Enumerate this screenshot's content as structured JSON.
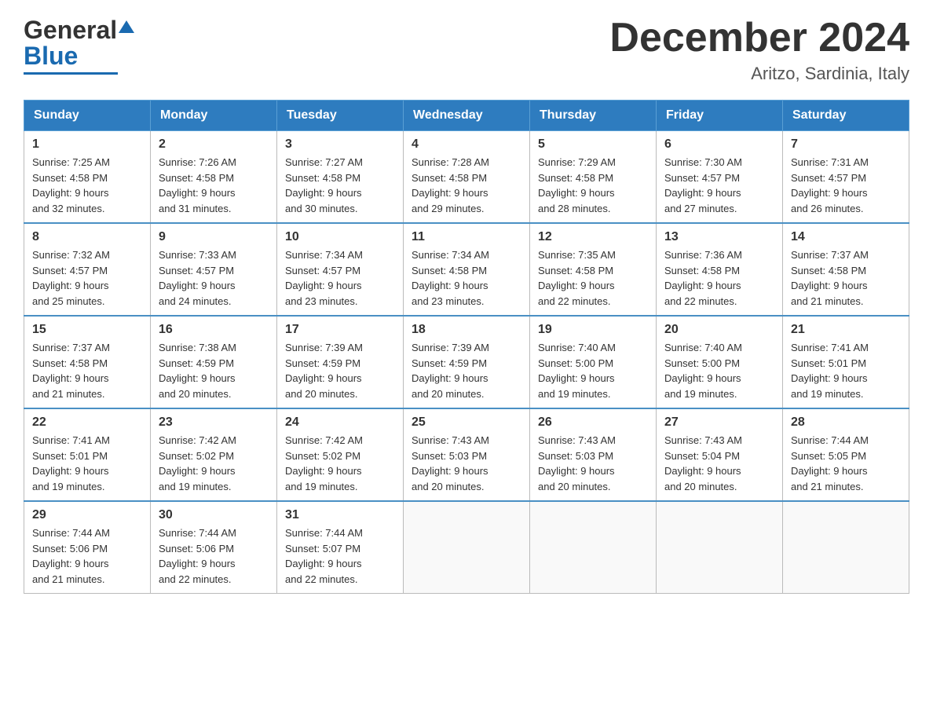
{
  "header": {
    "logo_general": "General",
    "logo_blue": "Blue",
    "main_title": "December 2024",
    "subtitle": "Aritzo, Sardinia, Italy"
  },
  "days_of_week": [
    "Sunday",
    "Monday",
    "Tuesday",
    "Wednesday",
    "Thursday",
    "Friday",
    "Saturday"
  ],
  "weeks": [
    [
      {
        "num": "1",
        "sunrise": "7:25 AM",
        "sunset": "4:58 PM",
        "daylight": "9 hours and 32 minutes."
      },
      {
        "num": "2",
        "sunrise": "7:26 AM",
        "sunset": "4:58 PM",
        "daylight": "9 hours and 31 minutes."
      },
      {
        "num": "3",
        "sunrise": "7:27 AM",
        "sunset": "4:58 PM",
        "daylight": "9 hours and 30 minutes."
      },
      {
        "num": "4",
        "sunrise": "7:28 AM",
        "sunset": "4:58 PM",
        "daylight": "9 hours and 29 minutes."
      },
      {
        "num": "5",
        "sunrise": "7:29 AM",
        "sunset": "4:58 PM",
        "daylight": "9 hours and 28 minutes."
      },
      {
        "num": "6",
        "sunrise": "7:30 AM",
        "sunset": "4:57 PM",
        "daylight": "9 hours and 27 minutes."
      },
      {
        "num": "7",
        "sunrise": "7:31 AM",
        "sunset": "4:57 PM",
        "daylight": "9 hours and 26 minutes."
      }
    ],
    [
      {
        "num": "8",
        "sunrise": "7:32 AM",
        "sunset": "4:57 PM",
        "daylight": "9 hours and 25 minutes."
      },
      {
        "num": "9",
        "sunrise": "7:33 AM",
        "sunset": "4:57 PM",
        "daylight": "9 hours and 24 minutes."
      },
      {
        "num": "10",
        "sunrise": "7:34 AM",
        "sunset": "4:57 PM",
        "daylight": "9 hours and 23 minutes."
      },
      {
        "num": "11",
        "sunrise": "7:34 AM",
        "sunset": "4:58 PM",
        "daylight": "9 hours and 23 minutes."
      },
      {
        "num": "12",
        "sunrise": "7:35 AM",
        "sunset": "4:58 PM",
        "daylight": "9 hours and 22 minutes."
      },
      {
        "num": "13",
        "sunrise": "7:36 AM",
        "sunset": "4:58 PM",
        "daylight": "9 hours and 22 minutes."
      },
      {
        "num": "14",
        "sunrise": "7:37 AM",
        "sunset": "4:58 PM",
        "daylight": "9 hours and 21 minutes."
      }
    ],
    [
      {
        "num": "15",
        "sunrise": "7:37 AM",
        "sunset": "4:58 PM",
        "daylight": "9 hours and 21 minutes."
      },
      {
        "num": "16",
        "sunrise": "7:38 AM",
        "sunset": "4:59 PM",
        "daylight": "9 hours and 20 minutes."
      },
      {
        "num": "17",
        "sunrise": "7:39 AM",
        "sunset": "4:59 PM",
        "daylight": "9 hours and 20 minutes."
      },
      {
        "num": "18",
        "sunrise": "7:39 AM",
        "sunset": "4:59 PM",
        "daylight": "9 hours and 20 minutes."
      },
      {
        "num": "19",
        "sunrise": "7:40 AM",
        "sunset": "5:00 PM",
        "daylight": "9 hours and 19 minutes."
      },
      {
        "num": "20",
        "sunrise": "7:40 AM",
        "sunset": "5:00 PM",
        "daylight": "9 hours and 19 minutes."
      },
      {
        "num": "21",
        "sunrise": "7:41 AM",
        "sunset": "5:01 PM",
        "daylight": "9 hours and 19 minutes."
      }
    ],
    [
      {
        "num": "22",
        "sunrise": "7:41 AM",
        "sunset": "5:01 PM",
        "daylight": "9 hours and 19 minutes."
      },
      {
        "num": "23",
        "sunrise": "7:42 AM",
        "sunset": "5:02 PM",
        "daylight": "9 hours and 19 minutes."
      },
      {
        "num": "24",
        "sunrise": "7:42 AM",
        "sunset": "5:02 PM",
        "daylight": "9 hours and 19 minutes."
      },
      {
        "num": "25",
        "sunrise": "7:43 AM",
        "sunset": "5:03 PM",
        "daylight": "9 hours and 20 minutes."
      },
      {
        "num": "26",
        "sunrise": "7:43 AM",
        "sunset": "5:03 PM",
        "daylight": "9 hours and 20 minutes."
      },
      {
        "num": "27",
        "sunrise": "7:43 AM",
        "sunset": "5:04 PM",
        "daylight": "9 hours and 20 minutes."
      },
      {
        "num": "28",
        "sunrise": "7:44 AM",
        "sunset": "5:05 PM",
        "daylight": "9 hours and 21 minutes."
      }
    ],
    [
      {
        "num": "29",
        "sunrise": "7:44 AM",
        "sunset": "5:06 PM",
        "daylight": "9 hours and 21 minutes."
      },
      {
        "num": "30",
        "sunrise": "7:44 AM",
        "sunset": "5:06 PM",
        "daylight": "9 hours and 22 minutes."
      },
      {
        "num": "31",
        "sunrise": "7:44 AM",
        "sunset": "5:07 PM",
        "daylight": "9 hours and 22 minutes."
      },
      null,
      null,
      null,
      null
    ]
  ]
}
